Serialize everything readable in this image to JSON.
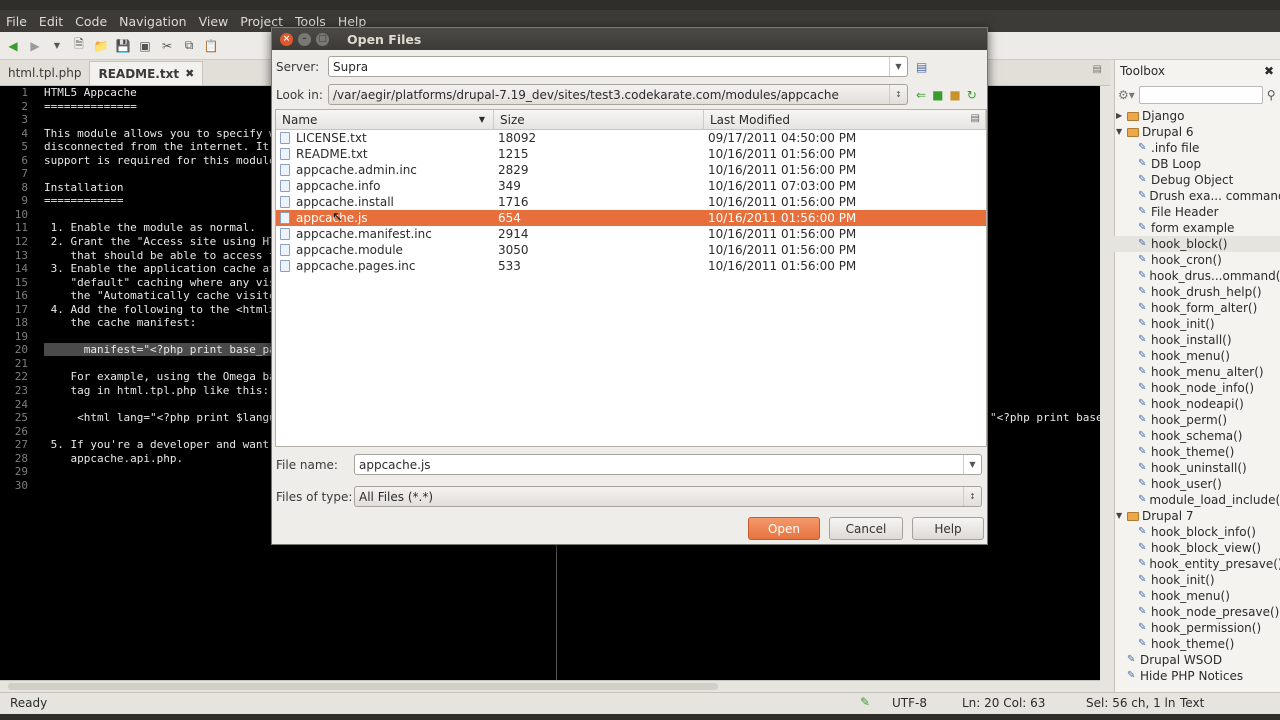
{
  "menubar": {
    "items": [
      "File",
      "Edit",
      "Code",
      "Navigation",
      "View",
      "Project",
      "Tools",
      "Help"
    ]
  },
  "tabs": [
    {
      "label": "html.tpl.php"
    },
    {
      "label": "README.txt",
      "close": "✖"
    }
  ],
  "editor": {
    "line_numbers": [
      "1",
      "2",
      "3",
      "4",
      "5",
      "6",
      "7",
      "8",
      "9",
      "10",
      "11",
      "12",
      "13",
      "14",
      "15",
      "16",
      "17",
      "18",
      "19",
      "20",
      "21",
      "22",
      "23",
      "24",
      "25",
      "26",
      "27",
      "28",
      "29",
      "30"
    ],
    "lines": [
      "HTML5 Appcache",
      "==============",
      "",
      "This module allows you to specify wh",
      "disconnected from the internet. It u",
      "support is required for this module",
      "",
      "Installation",
      "============",
      "",
      " 1. Enable the module as normal.",
      " 2. Grant the \"Access site using HTM",
      "    that should be able to access th",
      " 3. Enable the application cache at",
      "    \"default\" caching where any vis",
      "    the \"Automatically cache visite",
      " 4. Add the following to the <html>",
      "    the cache manifest:",
      "",
      "      manifest=\"<?php print base_pa",
      "",
      "    For example, using the Omega bas",
      "    tag in html.tpl.php like this:",
      "",
      "     <html lang=\"<?php print $langua",
      "",
      " 5. If you're a developer and want t",
      "    appcache.api.php.",
      "",
      ""
    ],
    "right_fragment": "\"<?php print base_"
  },
  "toolbox": {
    "title": "Toolbox",
    "close": "✖",
    "search_placeholder": "",
    "items": [
      {
        "label": "Django",
        "level": 0,
        "type": "folder",
        "expanded": false
      },
      {
        "label": "Drupal 6",
        "level": 0,
        "type": "folder",
        "expanded": true
      },
      {
        "label": ".info file",
        "level": 1
      },
      {
        "label": "DB Loop",
        "level": 1
      },
      {
        "label": "Debug Object",
        "level": 1
      },
      {
        "label": "Drush exa... commands",
        "level": 1
      },
      {
        "label": "File Header",
        "level": 1
      },
      {
        "label": "form example",
        "level": 1
      },
      {
        "label": "hook_block()",
        "level": 1,
        "highlight": true
      },
      {
        "label": "hook_cron()",
        "level": 1
      },
      {
        "label": "hook_drus...ommand()",
        "level": 1
      },
      {
        "label": "hook_drush_help()",
        "level": 1
      },
      {
        "label": "hook_form_alter()",
        "level": 1
      },
      {
        "label": "hook_init()",
        "level": 1
      },
      {
        "label": "hook_install()",
        "level": 1
      },
      {
        "label": "hook_menu()",
        "level": 1
      },
      {
        "label": "hook_menu_alter()",
        "level": 1
      },
      {
        "label": "hook_node_info()",
        "level": 1
      },
      {
        "label": "hook_nodeapi()",
        "level": 1
      },
      {
        "label": "hook_perm()",
        "level": 1
      },
      {
        "label": "hook_schema()",
        "level": 1
      },
      {
        "label": "hook_theme()",
        "level": 1
      },
      {
        "label": "hook_uninstall()",
        "level": 1
      },
      {
        "label": "hook_user()",
        "level": 1
      },
      {
        "label": "module_load_include()",
        "level": 1
      },
      {
        "label": "Drupal 7",
        "level": 0,
        "type": "folder",
        "expanded": true
      },
      {
        "label": "hook_block_info()",
        "level": 1
      },
      {
        "label": "hook_block_view()",
        "level": 1
      },
      {
        "label": "hook_entity_presave()",
        "level": 1
      },
      {
        "label": "hook_init()",
        "level": 1
      },
      {
        "label": "hook_menu()",
        "level": 1
      },
      {
        "label": "hook_node_presave()",
        "level": 1
      },
      {
        "label": "hook_permission()",
        "level": 1
      },
      {
        "label": "hook_theme()",
        "level": 1
      },
      {
        "label": "Drupal WSOD",
        "level": 0,
        "type": "snippet"
      },
      {
        "label": "Hide PHP Notices",
        "level": 0,
        "type": "snippet"
      }
    ]
  },
  "status": {
    "left": "Ready",
    "encoding": "UTF-8",
    "position": "Ln: 20 Col: 63",
    "selection": "Sel: 56 ch, 1 ln",
    "mode": "Text"
  },
  "dialog": {
    "title": "Open Files",
    "server_label": "Server:",
    "server_value": "Supra",
    "lookin_label": "Look in:",
    "lookin_value": "/var/aegir/platforms/drupal-7.19_dev/sites/test3.codekarate.com/modules/appcache",
    "columns": {
      "name": "Name",
      "size": "Size",
      "modified": "Last Modified"
    },
    "files": [
      {
        "name": "LICENSE.txt",
        "size": "18092",
        "modified": "09/17/2011 04:50:00 PM"
      },
      {
        "name": "README.txt",
        "size": "1215",
        "modified": "10/16/2011 01:56:00 PM"
      },
      {
        "name": "appcache.admin.inc",
        "size": "2829",
        "modified": "10/16/2011 01:56:00 PM"
      },
      {
        "name": "appcache.info",
        "size": "349",
        "modified": "10/16/2011 07:03:00 PM"
      },
      {
        "name": "appcache.install",
        "size": "1716",
        "modified": "10/16/2011 01:56:00 PM"
      },
      {
        "name": "appcache.js",
        "size": "654",
        "modified": "10/16/2011 01:56:00 PM",
        "selected": true
      },
      {
        "name": "appcache.manifest.inc",
        "size": "2914",
        "modified": "10/16/2011 01:56:00 PM"
      },
      {
        "name": "appcache.module",
        "size": "3050",
        "modified": "10/16/2011 01:56:00 PM"
      },
      {
        "name": "appcache.pages.inc",
        "size": "533",
        "modified": "10/16/2011 01:56:00 PM"
      }
    ],
    "filename_label": "File name:",
    "filename_value": "appcache.js",
    "filetype_label": "Files of type:",
    "filetype_value": "All Files (*.*)",
    "open_label": "Open",
    "cancel_label": "Cancel",
    "help_label": "Help"
  },
  "colors": {
    "accent": "#e76f3c",
    "menubar": "#3c3b37",
    "editor_bg": "#000000"
  }
}
